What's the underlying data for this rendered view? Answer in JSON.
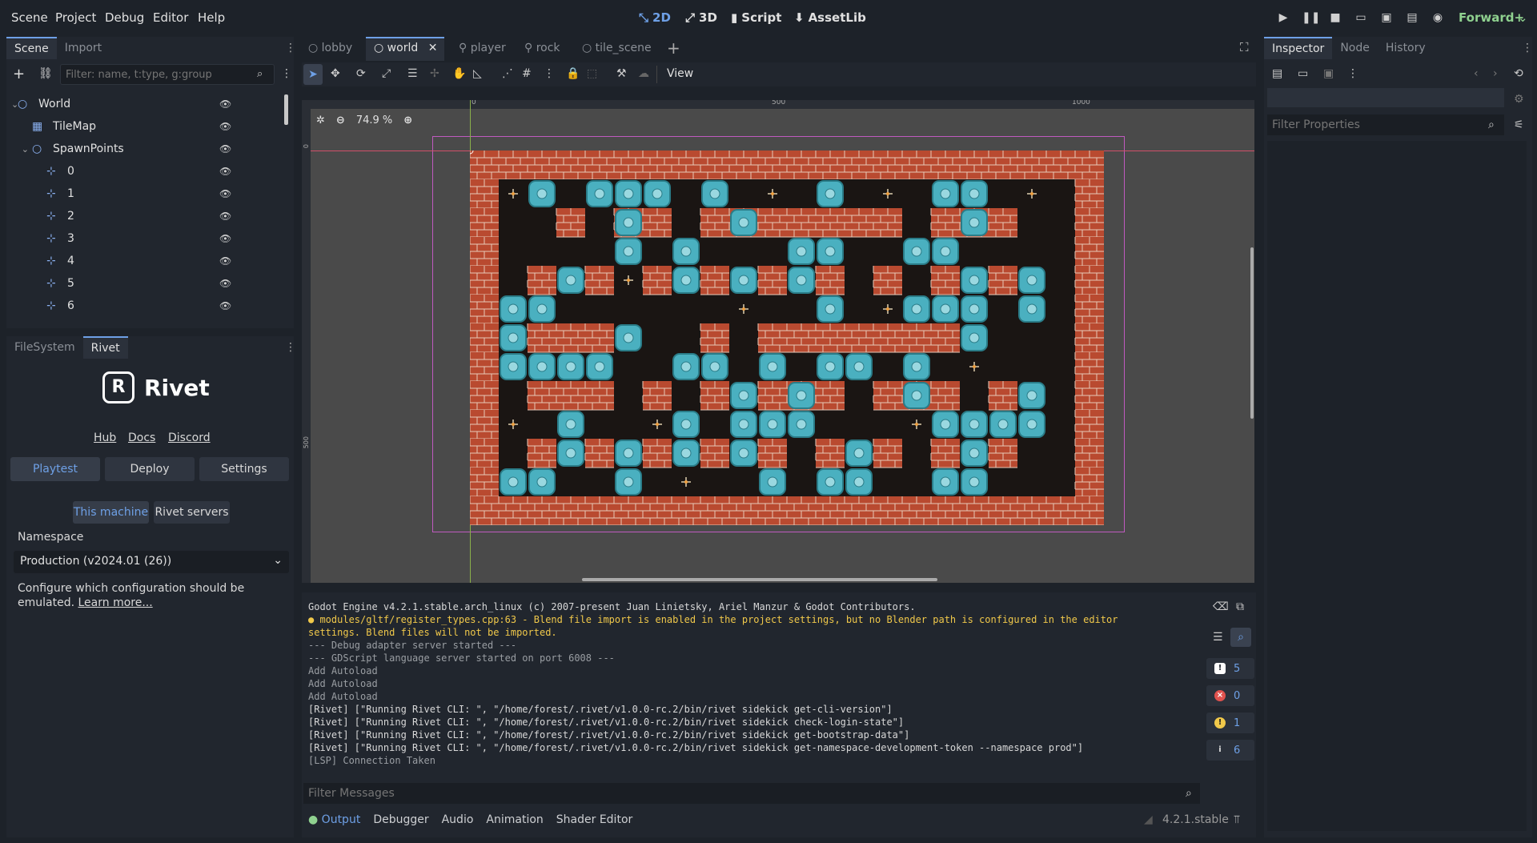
{
  "menu": [
    "Scene",
    "Project",
    "Debug",
    "Editor",
    "Help"
  ],
  "modes": {
    "m2d": "2D",
    "m3d": "3D",
    "script": "Script",
    "assetlib": "AssetLib"
  },
  "renderer": "Forward+",
  "scene_dock": {
    "tabs": [
      "Scene",
      "Import"
    ],
    "filter_placeholder": "Filter: name, t:type, g:group",
    "nodes": [
      {
        "label": "World",
        "indent": 0,
        "icon": "node2d-icon",
        "expand": "v"
      },
      {
        "label": "TileMap",
        "indent": 1,
        "icon": "tilemap-icon",
        "expand": ""
      },
      {
        "label": "SpawnPoints",
        "indent": 1,
        "icon": "node2d-icon",
        "expand": "v"
      },
      {
        "label": "0",
        "indent": 2,
        "icon": "marker2d-icon",
        "expand": ""
      },
      {
        "label": "1",
        "indent": 2,
        "icon": "marker2d-icon",
        "expand": ""
      },
      {
        "label": "2",
        "indent": 2,
        "icon": "marker2d-icon",
        "expand": ""
      },
      {
        "label": "3",
        "indent": 2,
        "icon": "marker2d-icon",
        "expand": ""
      },
      {
        "label": "4",
        "indent": 2,
        "icon": "marker2d-icon",
        "expand": ""
      },
      {
        "label": "5",
        "indent": 2,
        "icon": "marker2d-icon",
        "expand": ""
      },
      {
        "label": "6",
        "indent": 2,
        "icon": "marker2d-icon",
        "expand": ""
      }
    ]
  },
  "bottom_dock": {
    "tabs": [
      "FileSystem",
      "Rivet"
    ],
    "logo": "Rivet",
    "links": [
      "Hub",
      "Docs",
      "Discord"
    ],
    "buttons": [
      "Playtest",
      "Deploy",
      "Settings"
    ],
    "sub_buttons": [
      "This machine",
      "Rivet servers"
    ],
    "namespace_label": "Namespace",
    "namespace_value": "Production (v2024.01 (26))",
    "help_text": "Configure which configuration should be emulated.",
    "learn_more": "Learn more..."
  },
  "editor_tabs": [
    "lobby",
    "world",
    "player",
    "rock",
    "tile_scene"
  ],
  "toolbar": {
    "view": "View",
    "zoom": "74.9 %"
  },
  "ruler": {
    "t0": "0",
    "t500": "500",
    "t1000": "1000",
    "v0": "0",
    "v500": "500"
  },
  "console": {
    "lines": [
      {
        "text": "Godot Engine v4.2.1.stable.arch_linux (c) 2007-present Juan Linietsky, Ariel Manzur & Godot Contributors.",
        "color": "#d8d8d8"
      },
      {
        "text": "● modules/gltf/register_types.cpp:63 - Blend file import is enabled in the project settings, but no Blender path is configured in the editor",
        "color": "#f0c84a"
      },
      {
        "text": "settings. Blend files will not be imported.",
        "color": "#f0c84a"
      },
      {
        "text": "--- Debug adapter server started ---",
        "color": "#9a9ea3"
      },
      {
        "text": "--- GDScript language server started on port 6008 ---",
        "color": "#9a9ea3"
      },
      {
        "text": "Add Autoload",
        "color": "#9a9ea3"
      },
      {
        "text": "Add Autoload",
        "color": "#9a9ea3"
      },
      {
        "text": "Add Autoload",
        "color": "#9a9ea3"
      },
      {
        "text": "[Rivet] [\"Running Rivet CLI: \", \"/home/forest/.rivet/v1.0.0-rc.2/bin/rivet sidekick get-cli-version\"]",
        "color": "#d8d8d8"
      },
      {
        "text": "[Rivet] [\"Running Rivet CLI: \", \"/home/forest/.rivet/v1.0.0-rc.2/bin/rivet sidekick check-login-state\"]",
        "color": "#d8d8d8"
      },
      {
        "text": "[Rivet] [\"Running Rivet CLI: \", \"/home/forest/.rivet/v1.0.0-rc.2/bin/rivet sidekick get-bootstrap-data\"]",
        "color": "#d8d8d8"
      },
      {
        "text": "[Rivet] [\"Running Rivet CLI: \", \"/home/forest/.rivet/v1.0.0-rc.2/bin/rivet sidekick get-namespace-development-token --namespace prod\"]",
        "color": "#d8d8d8"
      },
      {
        "text": "[LSP] Connection Taken",
        "color": "#9a9ea3"
      }
    ],
    "filter_placeholder": "Filter Messages",
    "counts": {
      "errors_total": "5",
      "errors": "0",
      "warnings": "1",
      "info": "6"
    },
    "bottom_tabs": [
      "Output",
      "Debugger",
      "Audio",
      "Animation",
      "Shader Editor"
    ],
    "version": "4.2.1.stable"
  },
  "inspector": {
    "tabs": [
      "Inspector",
      "Node",
      "History"
    ],
    "filter_placeholder": "Filter Properties"
  },
  "colors": {
    "accent": "#6ea0e6",
    "brick": "#b94a30",
    "floor": "#1a1513",
    "rock": "#4ab0c0"
  },
  "grid": [
    "1111111111111111111111",
    "1000000000000000000001",
    "1000000000000000000001",
    "1000000000000000000001",
    "1000000000000000000001",
    "1000000000000000000001",
    "1000000000000000000001",
    "1000000000000000000001",
    "1000000000000000000001",
    "1000000000000000000001",
    "1000000000000000000001",
    "1000000000000000000001",
    "1111111111111111111111"
  ],
  "walls": [
    [
      3,
      2
    ],
    [
      5,
      2
    ],
    [
      6,
      2
    ],
    [
      8,
      2
    ],
    [
      9,
      2
    ],
    [
      10,
      2
    ],
    [
      11,
      2
    ],
    [
      12,
      2
    ],
    [
      13,
      2
    ],
    [
      14,
      2
    ],
    [
      16,
      2
    ],
    [
      17,
      2
    ],
    [
      18,
      2
    ],
    [
      2,
      4
    ],
    [
      4,
      4
    ],
    [
      6,
      4
    ],
    [
      8,
      4
    ],
    [
      10,
      4
    ],
    [
      12,
      4
    ],
    [
      14,
      4
    ],
    [
      16,
      4
    ],
    [
      18,
      4
    ],
    [
      2,
      6
    ],
    [
      3,
      6
    ],
    [
      4,
      6
    ],
    [
      8,
      6
    ],
    [
      10,
      6
    ],
    [
      11,
      6
    ],
    [
      12,
      6
    ],
    [
      13,
      6
    ],
    [
      14,
      6
    ],
    [
      15,
      6
    ],
    [
      16,
      6
    ],
    [
      2,
      8
    ],
    [
      3,
      8
    ],
    [
      4,
      8
    ],
    [
      6,
      8
    ],
    [
      8,
      8
    ],
    [
      10,
      8
    ],
    [
      11,
      8
    ],
    [
      12,
      8
    ],
    [
      14,
      8
    ],
    [
      15,
      8
    ],
    [
      16,
      8
    ],
    [
      18,
      8
    ],
    [
      2,
      10
    ],
    [
      4,
      10
    ],
    [
      6,
      10
    ],
    [
      8,
      10
    ],
    [
      10,
      10
    ],
    [
      12,
      10
    ],
    [
      14,
      10
    ],
    [
      16,
      10
    ],
    [
      18,
      10
    ]
  ],
  "rocks": [
    [
      2,
      1
    ],
    [
      4,
      1
    ],
    [
      5,
      1
    ],
    [
      6,
      1
    ],
    [
      8,
      1
    ],
    [
      12,
      1
    ],
    [
      16,
      1
    ],
    [
      17,
      1
    ],
    [
      5,
      2
    ],
    [
      9,
      2
    ],
    [
      17,
      2
    ],
    [
      5,
      3
    ],
    [
      7,
      3
    ],
    [
      11,
      3
    ],
    [
      12,
      3
    ],
    [
      15,
      3
    ],
    [
      16,
      3
    ],
    [
      3,
      4
    ],
    [
      7,
      4
    ],
    [
      9,
      4
    ],
    [
      11,
      4
    ],
    [
      17,
      4
    ],
    [
      19,
      4
    ],
    [
      1,
      5
    ],
    [
      2,
      5
    ],
    [
      12,
      5
    ],
    [
      15,
      5
    ],
    [
      16,
      5
    ],
    [
      17,
      5
    ],
    [
      19,
      5
    ],
    [
      1,
      6
    ],
    [
      5,
      6
    ],
    [
      17,
      6
    ],
    [
      1,
      7
    ],
    [
      2,
      7
    ],
    [
      3,
      7
    ],
    [
      4,
      7
    ],
    [
      7,
      7
    ],
    [
      8,
      7
    ],
    [
      10,
      7
    ],
    [
      12,
      7
    ],
    [
      13,
      7
    ],
    [
      15,
      7
    ],
    [
      9,
      8
    ],
    [
      11,
      8
    ],
    [
      15,
      8
    ],
    [
      19,
      8
    ],
    [
      3,
      9
    ],
    [
      7,
      9
    ],
    [
      9,
      9
    ],
    [
      10,
      9
    ],
    [
      11,
      9
    ],
    [
      16,
      9
    ],
    [
      17,
      9
    ],
    [
      18,
      9
    ],
    [
      19,
      9
    ],
    [
      3,
      10
    ],
    [
      5,
      10
    ],
    [
      7,
      10
    ],
    [
      9,
      10
    ],
    [
      13,
      10
    ],
    [
      17,
      10
    ],
    [
      1,
      11
    ],
    [
      2,
      11
    ],
    [
      5,
      11
    ],
    [
      10,
      11
    ],
    [
      12,
      11
    ],
    [
      13,
      11
    ],
    [
      16,
      11
    ],
    [
      17,
      11
    ]
  ],
  "spawns": [
    [
      1,
      1
    ],
    [
      10,
      1
    ],
    [
      14,
      1
    ],
    [
      19,
      1
    ],
    [
      5,
      4
    ],
    [
      9,
      5
    ],
    [
      14,
      5
    ],
    [
      17,
      7
    ],
    [
      1,
      9
    ],
    [
      6,
      9
    ],
    [
      15,
      9
    ],
    [
      7,
      11
    ]
  ]
}
